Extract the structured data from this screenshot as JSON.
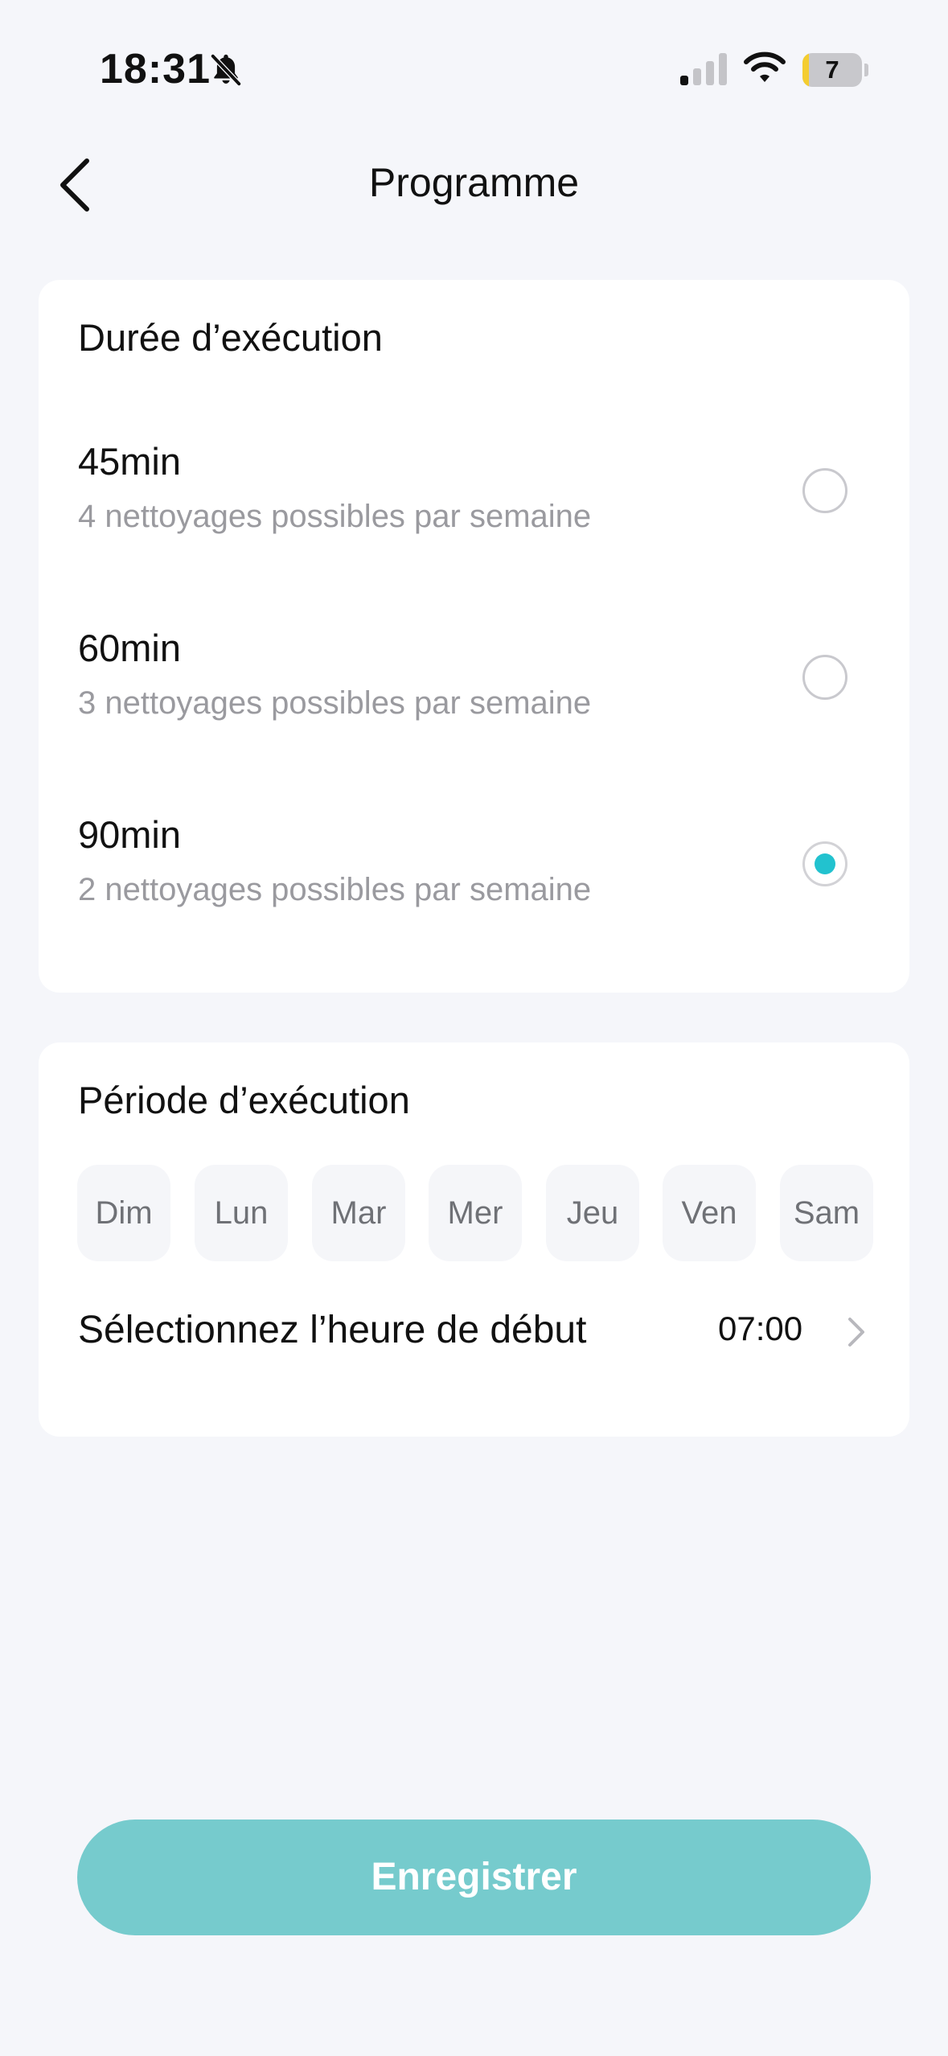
{
  "status_bar": {
    "time": "18:31",
    "battery_level": "7",
    "battery_fraction": 0.07,
    "icons": [
      "bell-off-icon",
      "signal-icon",
      "wifi-icon",
      "battery-icon"
    ]
  },
  "header": {
    "back_icon": "chevron-left-icon",
    "title": "Programme"
  },
  "duration": {
    "title": "Durée d’exécution",
    "options": [
      {
        "label": "45min",
        "description": "4 nettoyages possibles par semaine",
        "selected": false
      },
      {
        "label": "60min",
        "description": "3 nettoyages possibles par semaine",
        "selected": false
      },
      {
        "label": "90min",
        "description": "2 nettoyages possibles par semaine",
        "selected": true
      }
    ]
  },
  "period": {
    "title": "Période d’exécution",
    "days": [
      "Dim",
      "Lun",
      "Mar",
      "Mer",
      "Jeu",
      "Ven",
      "Sam"
    ],
    "start_time_label": "Sélectionnez l’heure de début",
    "start_time_value": "07:00"
  },
  "footer": {
    "save_label": "Enregistrer"
  },
  "colors": {
    "accent": "#22c2cf",
    "button": "#76cbcd",
    "background": "#f5f6fa",
    "battery_fill": "#f4cd2f"
  }
}
